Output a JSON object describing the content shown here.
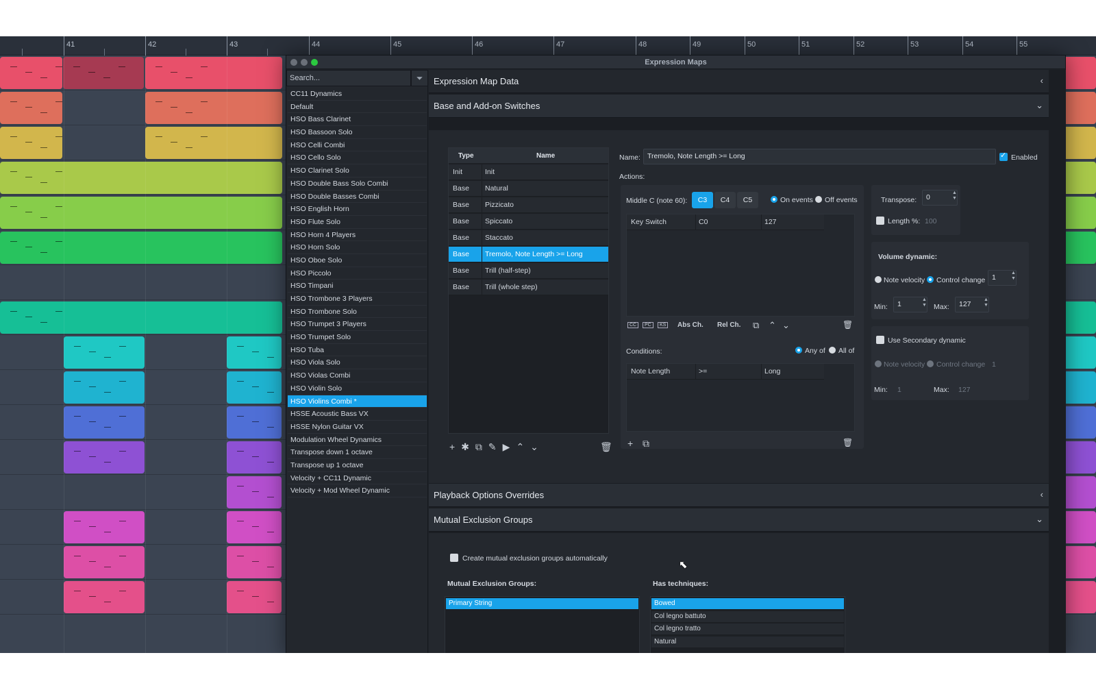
{
  "ruler": {
    "bars": [
      "41",
      "42",
      "43",
      "44",
      "45",
      "46",
      "47",
      "48",
      "49",
      "50",
      "51",
      "52",
      "53",
      "54",
      "55"
    ]
  },
  "window": {
    "title": "Expression Maps"
  },
  "sidebar": {
    "search_placeholder": "Search...",
    "items": [
      "CC11 Dynamics",
      "Default",
      "HSO Bass Clarinet",
      "HSO Bassoon Solo",
      "HSO Celli Combi",
      "HSO Cello Solo",
      "HSO Clarinet Solo",
      "HSO Double Bass Solo Combi",
      "HSO Double Basses Combi",
      "HSO English Horn",
      "HSO Flute Solo",
      "HSO Horn 4 Players",
      "HSO Horn Solo",
      "HSO Oboe Solo",
      "HSO Piccolo",
      "HSO Timpani",
      "HSO Trombone 3 Players",
      "HSO Trombone Solo",
      "HSO Trumpet 3 Players",
      "HSO Trumpet Solo",
      "HSO Tuba",
      "HSO Viola Solo",
      "HSO Violas Combi",
      "HSO Violin Solo",
      "HSO Violins Combi *",
      "HSSE Acoustic Bass VX",
      "HSSE Nylon Guitar VX",
      "Modulation Wheel Dynamics",
      "Transpose down 1 octave",
      "Transpose up 1 octave",
      "Velocity + CC11 Dynamic",
      "Velocity + Mod Wheel Dynamic"
    ],
    "selected_index": 24
  },
  "main": {
    "header": "Expression Map Data",
    "sections": {
      "base_switches": "Base and Add-on Switches",
      "playback": "Playback Options Overrides",
      "mutual": "Mutual Exclusion Groups"
    }
  },
  "switches": {
    "col_type": "Type",
    "col_name": "Name",
    "rows": [
      {
        "type": "Init",
        "name": "Init"
      },
      {
        "type": "Base",
        "name": "Natural"
      },
      {
        "type": "Base",
        "name": "Pizzicato"
      },
      {
        "type": "Base",
        "name": "Spiccato"
      },
      {
        "type": "Base",
        "name": "Staccato"
      },
      {
        "type": "Base",
        "name": "Tremolo, Note Length >= Long"
      },
      {
        "type": "Base",
        "name": "Trill (half-step)"
      },
      {
        "type": "Base",
        "name": "Trill (whole step)"
      }
    ],
    "selected_index": 5
  },
  "detail": {
    "name_label": "Name:",
    "name_value": "Tremolo, Note Length >= Long",
    "enabled_label": "Enabled",
    "enabled": true,
    "actions_label": "Actions:",
    "middle_c_label": "Middle C (note 60):",
    "middle_c_options": [
      "C3",
      "C4",
      "C5"
    ],
    "middle_c_selected": "C3",
    "on_events": "On events",
    "off_events": "Off events",
    "action_row": {
      "kind": "Key Switch",
      "note": "C0",
      "value": "127"
    },
    "abs_ch": "Abs Ch.",
    "rel_ch": "Rel Ch.",
    "action_icons": [
      "CC",
      "PC",
      "KS"
    ],
    "conditions_label": "Conditions:",
    "any_of": "Any of",
    "all_of": "All of",
    "condition_row": {
      "param": "Note Length",
      "op": ">=",
      "value": "Long"
    },
    "transpose_label": "Transpose:",
    "transpose_value": "0",
    "length_label": "Length %:",
    "length_value": "100",
    "volume_label": "Volume dynamic:",
    "note_velocity": "Note velocity",
    "control_change": "Control change",
    "cc_value": "1",
    "min_label": "Min:",
    "min_value": "1",
    "max_label": "Max:",
    "max_value": "127",
    "secondary_label": "Use Secondary dynamic",
    "sec_cc_value": "1",
    "sec_min_value": "1",
    "sec_max_value": "127"
  },
  "mutual": {
    "auto_label": "Create mutual exclusion groups automatically",
    "groups_label": "Mutual Exclusion Groups:",
    "groups": [
      "Primary String"
    ],
    "techniques_label": "Has techniques:",
    "techniques": [
      "Bowed",
      "Col legno battuto",
      "Col legno tratto",
      "Natural"
    ]
  },
  "colors": {
    "accent": "#19a3ea",
    "window_bg": "#1f2329"
  }
}
